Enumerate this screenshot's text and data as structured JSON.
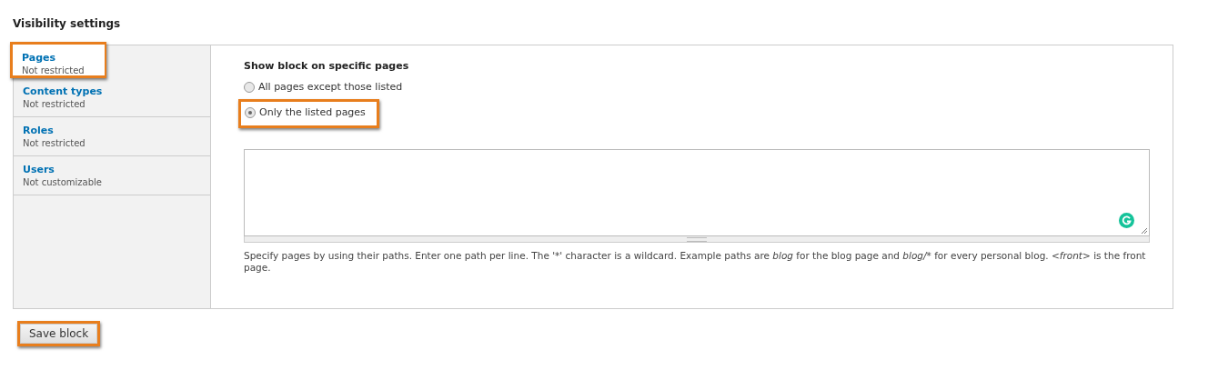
{
  "heading": "Visibility settings",
  "tabs": [
    {
      "label": "Pages",
      "summary": "Not restricted",
      "selected": true,
      "highlighted": true
    },
    {
      "label": "Content types",
      "summary": "Not restricted",
      "selected": false,
      "highlighted": false
    },
    {
      "label": "Roles",
      "summary": "Not restricted",
      "selected": false,
      "highlighted": false
    },
    {
      "label": "Users",
      "summary": "Not customizable",
      "selected": false,
      "highlighted": false
    }
  ],
  "pages": {
    "title": "Show block on specific pages",
    "options": [
      {
        "label": "All pages except those listed",
        "selected": false,
        "highlighted": false
      },
      {
        "label": "Only the listed pages",
        "selected": true,
        "highlighted": true
      }
    ],
    "help": [
      {
        "text": "Specify pages by using their paths. Enter one path per line. The '*' character is a wildcard. Example paths are ",
        "italic": false
      },
      {
        "text": "blog",
        "italic": true
      },
      {
        "text": " for the blog page and ",
        "italic": false
      },
      {
        "text": "blog/*",
        "italic": true
      },
      {
        "text": " for every personal blog. ",
        "italic": false
      },
      {
        "text": "<front>",
        "italic": true
      },
      {
        "text": " is the front page.",
        "italic": false
      }
    ]
  },
  "save_button": {
    "label": "Save block",
    "highlighted": true
  }
}
